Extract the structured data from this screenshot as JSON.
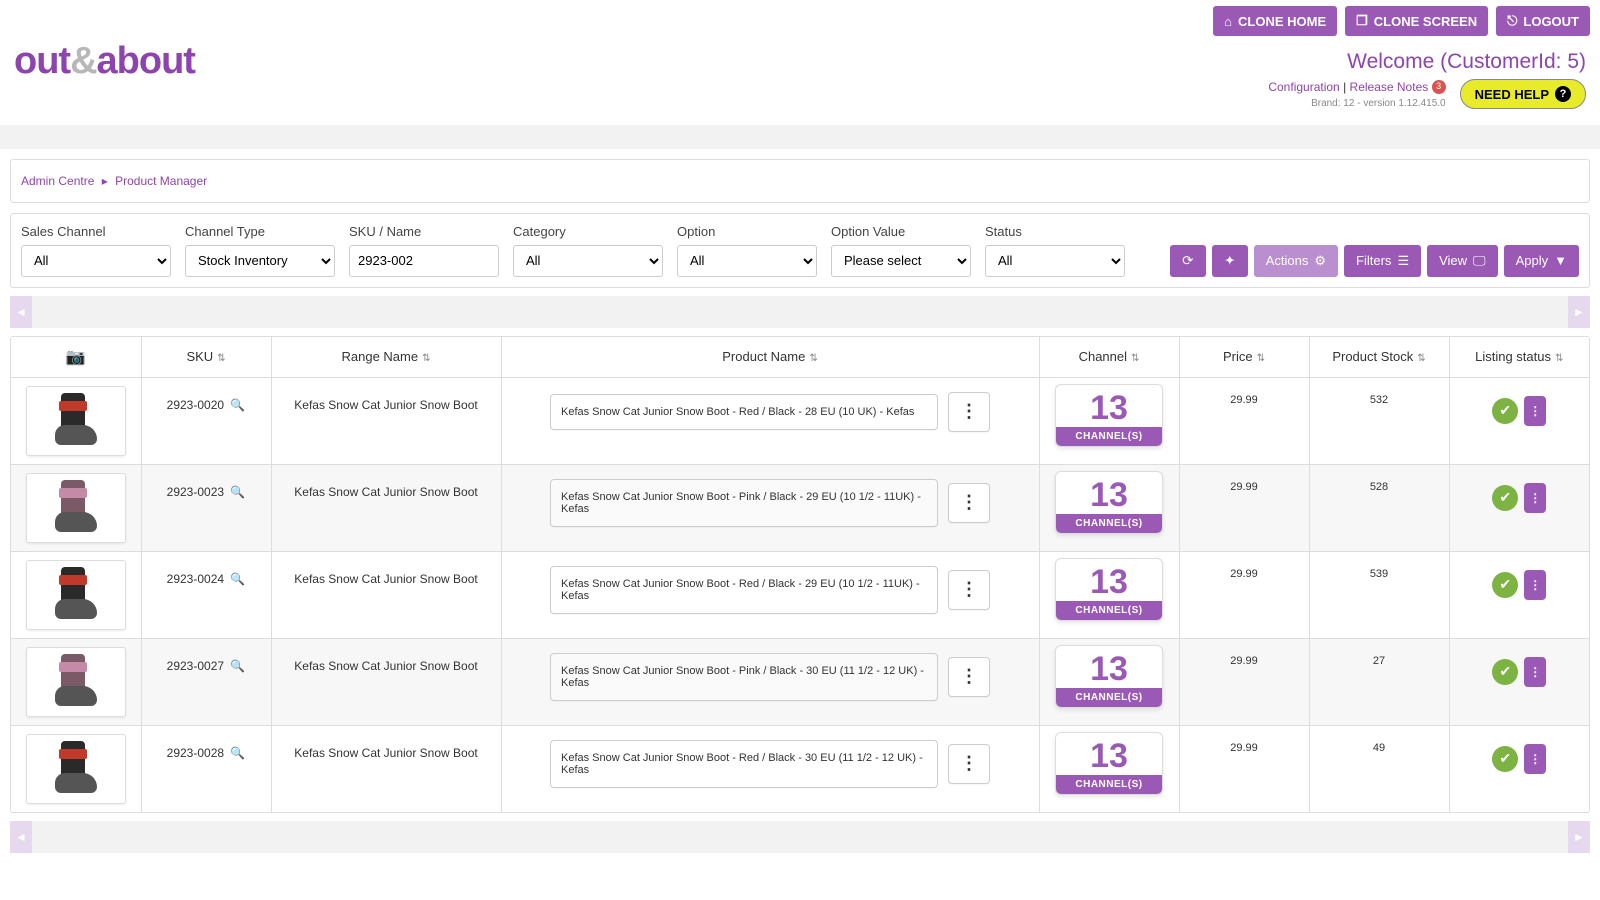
{
  "topbar": {
    "clone_home": "CLONE HOME",
    "clone_screen": "CLONE SCREEN",
    "logout": "LOGOUT"
  },
  "header": {
    "logo_pre": "out",
    "logo_amp": "&",
    "logo_post": "about",
    "welcome": "Welcome (CustomerId: 5)",
    "config": "Configuration",
    "release_notes": "Release Notes",
    "release_count": "3",
    "brand_line": "Brand: 12 - version 1.12.415.0",
    "need_help": "NEED HELP"
  },
  "breadcrumb": {
    "item1": "Admin Centre",
    "item2": "Product Manager"
  },
  "filters": {
    "sales_channel": {
      "label": "Sales Channel",
      "value": "All"
    },
    "channel_type": {
      "label": "Channel Type",
      "value": "Stock Inventory"
    },
    "sku_name": {
      "label": "SKU / Name",
      "value": "2923-002"
    },
    "category": {
      "label": "Category",
      "value": "All"
    },
    "option": {
      "label": "Option",
      "value": "All"
    },
    "option_value": {
      "label": "Option Value",
      "value": "Please select"
    },
    "status": {
      "label": "Status",
      "value": "All"
    },
    "actions_btn": "Actions",
    "filters_btn": "Filters",
    "view_btn": "View",
    "apply_btn": "Apply"
  },
  "columns": {
    "sku": "SKU",
    "range": "Range Name",
    "name": "Product Name",
    "channel": "Channel",
    "price": "Price",
    "stock": "Product Stock",
    "status": "Listing status"
  },
  "channel_line": "CHANNEL(S)",
  "rows": [
    {
      "sku": "2923-0020",
      "range": "Kefas Snow Cat Junior Snow Boot",
      "name": "Kefas Snow Cat Junior Snow Boot - Red / Black - 28 EU (10 UK) - Kefas",
      "channels": "13",
      "price": "29.99",
      "stock": "532",
      "color": "red"
    },
    {
      "sku": "2923-0023",
      "range": "Kefas Snow Cat Junior Snow Boot",
      "name": "Kefas Snow Cat Junior Snow Boot - Pink / Black - 29 EU (10 1/2 - 11UK) - Kefas",
      "channels": "13",
      "price": "29.99",
      "stock": "528",
      "color": "pink"
    },
    {
      "sku": "2923-0024",
      "range": "Kefas Snow Cat Junior Snow Boot",
      "name": "Kefas Snow Cat Junior Snow Boot - Red / Black - 29 EU (10 1/2 - 11UK) - Kefas",
      "channels": "13",
      "price": "29.99",
      "stock": "539",
      "color": "red"
    },
    {
      "sku": "2923-0027",
      "range": "Kefas Snow Cat Junior Snow Boot",
      "name": "Kefas Snow Cat Junior Snow Boot - Pink / Black - 30 EU (11 1/2 - 12 UK) - Kefas",
      "channels": "13",
      "price": "29.99",
      "stock": "27",
      "color": "pink"
    },
    {
      "sku": "2923-0028",
      "range": "Kefas Snow Cat Junior Snow Boot",
      "name": "Kefas Snow Cat Junior Snow Boot - Red / Black - 30 EU (11 1/2 - 12 UK) - Kefas",
      "channels": "13",
      "price": "29.99",
      "stock": "49",
      "color": "red"
    }
  ]
}
